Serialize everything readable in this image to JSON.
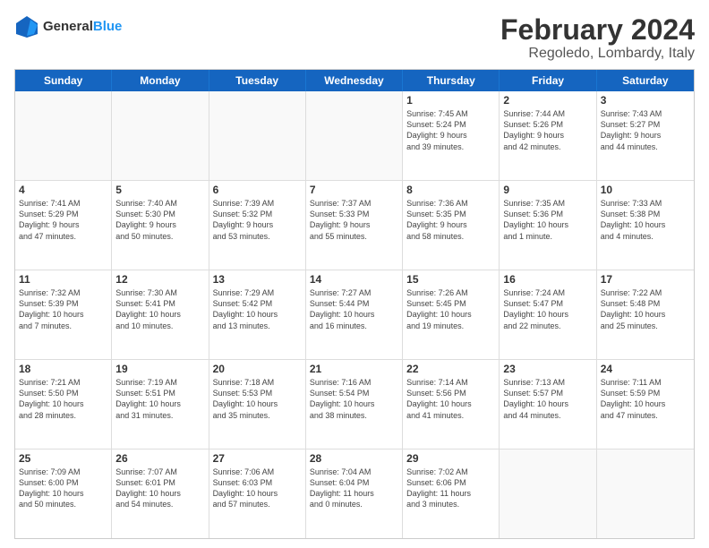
{
  "logo": {
    "text1": "General",
    "text2": "Blue"
  },
  "title": "February 2024",
  "subtitle": "Regoledo, Lombardy, Italy",
  "days": [
    "Sunday",
    "Monday",
    "Tuesday",
    "Wednesday",
    "Thursday",
    "Friday",
    "Saturday"
  ],
  "rows": [
    [
      {
        "day": "",
        "info": ""
      },
      {
        "day": "",
        "info": ""
      },
      {
        "day": "",
        "info": ""
      },
      {
        "day": "",
        "info": ""
      },
      {
        "day": "1",
        "info": "Sunrise: 7:45 AM\nSunset: 5:24 PM\nDaylight: 9 hours\nand 39 minutes."
      },
      {
        "day": "2",
        "info": "Sunrise: 7:44 AM\nSunset: 5:26 PM\nDaylight: 9 hours\nand 42 minutes."
      },
      {
        "day": "3",
        "info": "Sunrise: 7:43 AM\nSunset: 5:27 PM\nDaylight: 9 hours\nand 44 minutes."
      }
    ],
    [
      {
        "day": "4",
        "info": "Sunrise: 7:41 AM\nSunset: 5:29 PM\nDaylight: 9 hours\nand 47 minutes."
      },
      {
        "day": "5",
        "info": "Sunrise: 7:40 AM\nSunset: 5:30 PM\nDaylight: 9 hours\nand 50 minutes."
      },
      {
        "day": "6",
        "info": "Sunrise: 7:39 AM\nSunset: 5:32 PM\nDaylight: 9 hours\nand 53 minutes."
      },
      {
        "day": "7",
        "info": "Sunrise: 7:37 AM\nSunset: 5:33 PM\nDaylight: 9 hours\nand 55 minutes."
      },
      {
        "day": "8",
        "info": "Sunrise: 7:36 AM\nSunset: 5:35 PM\nDaylight: 9 hours\nand 58 minutes."
      },
      {
        "day": "9",
        "info": "Sunrise: 7:35 AM\nSunset: 5:36 PM\nDaylight: 10 hours\nand 1 minute."
      },
      {
        "day": "10",
        "info": "Sunrise: 7:33 AM\nSunset: 5:38 PM\nDaylight: 10 hours\nand 4 minutes."
      }
    ],
    [
      {
        "day": "11",
        "info": "Sunrise: 7:32 AM\nSunset: 5:39 PM\nDaylight: 10 hours\nand 7 minutes."
      },
      {
        "day": "12",
        "info": "Sunrise: 7:30 AM\nSunset: 5:41 PM\nDaylight: 10 hours\nand 10 minutes."
      },
      {
        "day": "13",
        "info": "Sunrise: 7:29 AM\nSunset: 5:42 PM\nDaylight: 10 hours\nand 13 minutes."
      },
      {
        "day": "14",
        "info": "Sunrise: 7:27 AM\nSunset: 5:44 PM\nDaylight: 10 hours\nand 16 minutes."
      },
      {
        "day": "15",
        "info": "Sunrise: 7:26 AM\nSunset: 5:45 PM\nDaylight: 10 hours\nand 19 minutes."
      },
      {
        "day": "16",
        "info": "Sunrise: 7:24 AM\nSunset: 5:47 PM\nDaylight: 10 hours\nand 22 minutes."
      },
      {
        "day": "17",
        "info": "Sunrise: 7:22 AM\nSunset: 5:48 PM\nDaylight: 10 hours\nand 25 minutes."
      }
    ],
    [
      {
        "day": "18",
        "info": "Sunrise: 7:21 AM\nSunset: 5:50 PM\nDaylight: 10 hours\nand 28 minutes."
      },
      {
        "day": "19",
        "info": "Sunrise: 7:19 AM\nSunset: 5:51 PM\nDaylight: 10 hours\nand 31 minutes."
      },
      {
        "day": "20",
        "info": "Sunrise: 7:18 AM\nSunset: 5:53 PM\nDaylight: 10 hours\nand 35 minutes."
      },
      {
        "day": "21",
        "info": "Sunrise: 7:16 AM\nSunset: 5:54 PM\nDaylight: 10 hours\nand 38 minutes."
      },
      {
        "day": "22",
        "info": "Sunrise: 7:14 AM\nSunset: 5:56 PM\nDaylight: 10 hours\nand 41 minutes."
      },
      {
        "day": "23",
        "info": "Sunrise: 7:13 AM\nSunset: 5:57 PM\nDaylight: 10 hours\nand 44 minutes."
      },
      {
        "day": "24",
        "info": "Sunrise: 7:11 AM\nSunset: 5:59 PM\nDaylight: 10 hours\nand 47 minutes."
      }
    ],
    [
      {
        "day": "25",
        "info": "Sunrise: 7:09 AM\nSunset: 6:00 PM\nDaylight: 10 hours\nand 50 minutes."
      },
      {
        "day": "26",
        "info": "Sunrise: 7:07 AM\nSunset: 6:01 PM\nDaylight: 10 hours\nand 54 minutes."
      },
      {
        "day": "27",
        "info": "Sunrise: 7:06 AM\nSunset: 6:03 PM\nDaylight: 10 hours\nand 57 minutes."
      },
      {
        "day": "28",
        "info": "Sunrise: 7:04 AM\nSunset: 6:04 PM\nDaylight: 11 hours\nand 0 minutes."
      },
      {
        "day": "29",
        "info": "Sunrise: 7:02 AM\nSunset: 6:06 PM\nDaylight: 11 hours\nand 3 minutes."
      },
      {
        "day": "",
        "info": ""
      },
      {
        "day": "",
        "info": ""
      }
    ]
  ]
}
